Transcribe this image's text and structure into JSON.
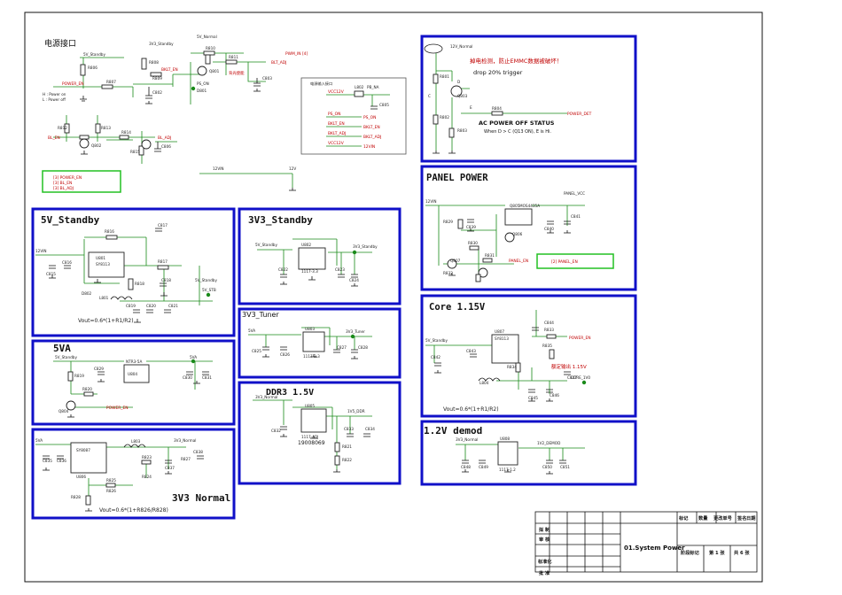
{
  "sheet": {
    "frame_color": "#111111",
    "block_color": "#1010c8",
    "net_color": "#1a8a1a",
    "label_color": "#c00000"
  },
  "blocks": {
    "power_connector": {
      "title": "电源接口",
      "nets": [
        "5V_Standby",
        "3V3_Standby",
        "5V_Normal",
        "PWM_IN [4]",
        "BLT_ADJ",
        "BKLT_EN",
        "PS_ON",
        "POWER_EN",
        "BL_EN",
        "BL_ADJ",
        "12VIN",
        "12V"
      ],
      "parts": [
        "R806",
        "R807",
        "R808",
        "R809",
        "R810",
        "R811",
        "R812",
        "R813",
        "R814",
        "R815",
        "C802",
        "C803",
        "C806",
        "Q801",
        "Q802",
        "D801"
      ],
      "legend": [
        "H : Power on",
        "L : Power off"
      ],
      "note_lines": [
        "[3]  POWER_EN",
        "[3]  BL_EN",
        "[3]  BL_ADJ"
      ],
      "lamp_text": "背光使能"
    },
    "input_box": {
      "title": "电源输入接口",
      "nets": [
        "VCC12V",
        "PS_ON",
        "BKLT_EN",
        "BKLT_ADJ",
        "VCC12V"
      ],
      "parts": [
        "L802",
        "C805",
        "PB_NA"
      ]
    },
    "power_down_detect": {
      "warning": "掉电检测，防止EMMC数据被破坏！",
      "drop": "drop 20% trigger",
      "status": "AC POWER OFF STATUS",
      "condition": "When D > C (Q13 ON),  E is Hi.",
      "net_in": "12V_Normal",
      "net_out": "POWER_DET",
      "parts": [
        "R801",
        "R802",
        "R803",
        "Q803",
        "R804"
      ],
      "pins": [
        "D",
        "C",
        "E"
      ]
    },
    "standby_5v": {
      "title": "5V_Standby",
      "formula": "Vout=0.6*(1+R1/R2)",
      "nets": [
        "12VIN",
        "5V_Standby",
        "5V_STB"
      ],
      "parts": [
        "U801",
        "L801",
        "R816",
        "R817",
        "R818",
        "C815",
        "C816",
        "C817",
        "C818",
        "C819",
        "C820",
        "C821",
        "D802"
      ],
      "ic_part": "SY8113"
    },
    "standby_3v3": {
      "title": "3V3_Standby",
      "nets": [
        "5V_Standby",
        "3V3_Standby"
      ],
      "parts": [
        "U802",
        "C822",
        "C823",
        "C824"
      ],
      "ic_part": "1117-3.3"
    },
    "tuner_3v3": {
      "title": "3V3_Tuner",
      "nets": [
        "5VA",
        "3V3_Tuner"
      ],
      "parts": [
        "U803",
        "C825",
        "C826",
        "C827",
        "C828"
      ],
      "ic_part": "1117-3.3"
    },
    "va5": {
      "title": "5VA",
      "nets": [
        "5V_Standby",
        "5VA",
        "POWER_EN"
      ],
      "parts": [
        "Q804",
        "U804",
        "R819",
        "R820",
        "C829",
        "C830",
        "C831"
      ],
      "ic_part": "NTR3-5A"
    },
    "ddr3": {
      "title": "DDR3  1.5V",
      "nets": [
        "3V3_Normal",
        "1V5_DDR"
      ],
      "parts": [
        "U805",
        "C832",
        "C833",
        "C834",
        "R821",
        "R822"
      ],
      "ic_part": "1117-ADJ",
      "code": "19008069"
    },
    "normal_3v3": {
      "title": "3V3 Normal",
      "formula": "Vout=0.6*(1+R826/R828)",
      "nets": [
        "5VA",
        "3V3_Normal"
      ],
      "parts": [
        "U806",
        "L803",
        "R823",
        "R824",
        "R825",
        "R826",
        "R827",
        "R828",
        "C835",
        "C836",
        "C837",
        "C838"
      ],
      "ic_part": "SY8087"
    },
    "panel_power": {
      "title": "PANEL POWER",
      "nets": [
        "12VIN",
        "PANEL_VCC",
        "PANEL_EN"
      ],
      "parts": [
        "Q805",
        "Q806",
        "Q807",
        "R829",
        "R830",
        "R831",
        "R832",
        "C839",
        "C840",
        "C841"
      ],
      "ic_part": "MOS4435A",
      "note": "[2]  PANEL_EN"
    },
    "core": {
      "title": "Core 1.15V",
      "formula": "Vout=0.6*(1+R1/R2)",
      "nets": [
        "5V_Standby",
        "CORE_1V0",
        "POWER_EN"
      ],
      "parts": [
        "U807",
        "L804",
        "R833",
        "R834",
        "R835",
        "C842",
        "C843",
        "C844",
        "C845",
        "C846",
        "C847"
      ],
      "ic_part": "SY8113",
      "red_note": "额定输出 1.15V"
    },
    "demod": {
      "title": "1.2V demod",
      "nets": [
        "3V3_Normal",
        "1V2_DEMOD"
      ],
      "parts": [
        "U808",
        "C848",
        "C849",
        "C850",
        "C851"
      ],
      "ic_part": "1117-1.2"
    }
  },
  "title_block": {
    "headers": [
      "标记",
      "数量",
      "更改单号",
      "签名",
      "日期"
    ],
    "rows": [
      "拟 制",
      "审 核",
      "",
      "标准化",
      "批 准"
    ],
    "doc_title": "01.System Power",
    "stage": "阶段标记",
    "sheet_label": "第 1 张",
    "total_label": "共 6 张"
  }
}
